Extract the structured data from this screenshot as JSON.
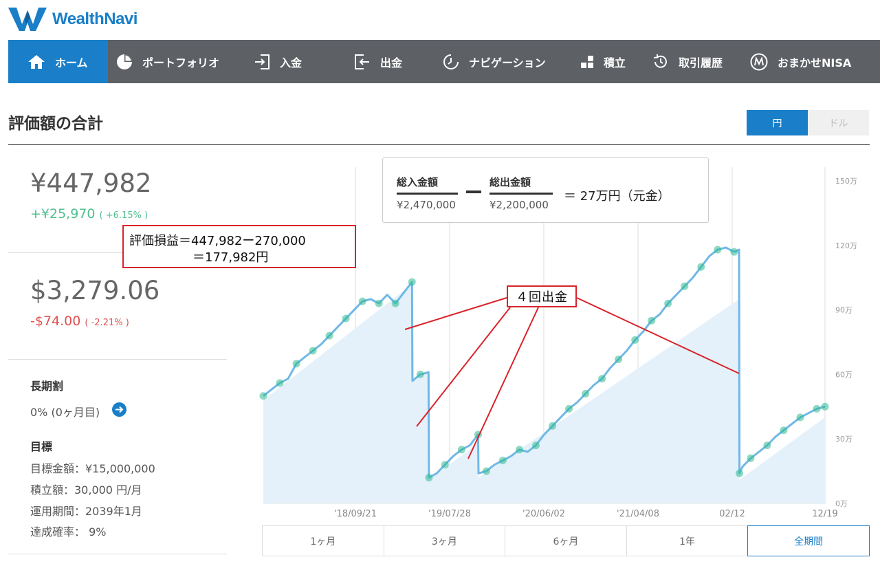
{
  "brand": {
    "name": "WealthNavi"
  },
  "nav": [
    {
      "label": "ホーム",
      "icon": "home-icon",
      "active": true
    },
    {
      "label": "ポートフォリオ",
      "icon": "pie-chart-icon",
      "active": false
    },
    {
      "label": "入金",
      "icon": "deposit-icon",
      "active": false
    },
    {
      "label": "出金",
      "icon": "withdraw-icon",
      "active": false
    },
    {
      "label": "ナビゲーション",
      "icon": "clock-icon",
      "active": false
    },
    {
      "label": "積立",
      "icon": "blocks-icon",
      "active": false
    },
    {
      "label": "取引履歴",
      "icon": "history-icon",
      "active": false
    },
    {
      "label": "おまかせNISA",
      "icon": "nisa-logo-icon",
      "active": false
    }
  ],
  "page": {
    "title": "評価額の合計"
  },
  "currency_toggle": {
    "yen": "円",
    "dollar": "ドル",
    "selected": "円"
  },
  "summary": {
    "yen_value": "¥447,982",
    "yen_change": "+¥25,970",
    "yen_change_pct": "( +6.15% )",
    "usd_value": "$3,279.06",
    "usd_change": "-$74.00",
    "usd_change_pct": "( -2.21% )"
  },
  "long_term": {
    "heading": "長期割",
    "status": "0% (0ヶ月目)"
  },
  "goal": {
    "heading": "目標",
    "target_amount": "目標金額：¥15,000,000",
    "monthly": "積立額：30,000 円/月",
    "period": "運用期間：2039年1月",
    "probability": "達成確率： 9%"
  },
  "annotations": {
    "profit_line1": "評価損益＝447,982ー270,000",
    "profit_line2": "＝177,982円",
    "withdrawals": "４回出金"
  },
  "formula": {
    "deposit_label": "総入金額",
    "deposit_amount": "¥2,470,000",
    "withdraw_label": "総出金額",
    "withdraw_amount": "¥2,200,000",
    "result": "＝ 27万円（元金）"
  },
  "chart_data": {
    "type": "area",
    "x_ticks": [
      "'18/09/21",
      "'19/07/28",
      "'20/06/02",
      "'21/04/08",
      "02/12",
      "12/19"
    ],
    "y_ticks": [
      "150万",
      "120万",
      "90万",
      "60万",
      "30万",
      "0万"
    ],
    "ylim": [
      0,
      150
    ],
    "y_unit": "万円",
    "grid": true,
    "series": [
      {
        "role": "valuation",
        "color": "#7cc0e8",
        "points": [
          [
            0,
            50
          ],
          [
            1,
            53
          ],
          [
            2,
            56
          ],
          [
            3,
            58
          ],
          [
            4,
            65
          ],
          [
            5,
            68
          ],
          [
            6,
            71
          ],
          [
            7,
            74
          ],
          [
            8,
            78
          ],
          [
            9,
            82
          ],
          [
            10,
            86
          ],
          [
            11,
            90
          ],
          [
            12,
            94
          ],
          [
            13,
            95
          ],
          [
            14,
            93
          ],
          [
            15,
            97
          ],
          [
            16,
            93
          ],
          [
            17,
            98
          ],
          [
            18,
            103
          ],
          [
            18.05,
            57
          ],
          [
            19,
            60
          ],
          [
            20,
            61
          ],
          [
            20.05,
            12
          ],
          [
            21,
            14
          ],
          [
            22,
            18
          ],
          [
            23,
            22
          ],
          [
            24,
            25
          ],
          [
            25,
            27
          ],
          [
            26,
            32
          ],
          [
            26.05,
            14
          ],
          [
            27,
            15
          ],
          [
            28,
            18
          ],
          [
            29,
            20
          ],
          [
            30,
            22
          ],
          [
            31,
            25
          ],
          [
            32,
            24
          ],
          [
            33,
            27
          ],
          [
            34,
            32
          ],
          [
            35,
            36
          ],
          [
            36,
            40
          ],
          [
            37,
            44
          ],
          [
            38,
            47
          ],
          [
            39,
            51
          ],
          [
            40,
            55
          ],
          [
            41,
            58
          ],
          [
            42,
            63
          ],
          [
            43,
            67
          ],
          [
            44,
            71
          ],
          [
            45,
            76
          ],
          [
            46,
            80
          ],
          [
            47,
            85
          ],
          [
            48,
            88
          ],
          [
            49,
            93
          ],
          [
            50,
            97
          ],
          [
            51,
            101
          ],
          [
            52,
            105
          ],
          [
            53,
            110
          ],
          [
            54,
            115
          ],
          [
            55,
            118
          ],
          [
            56,
            119
          ],
          [
            57,
            117
          ],
          [
            57.6,
            118
          ],
          [
            57.65,
            14
          ],
          [
            58,
            17
          ],
          [
            59,
            21
          ],
          [
            60,
            24
          ],
          [
            61,
            27
          ],
          [
            62,
            31
          ],
          [
            63,
            34
          ],
          [
            64,
            37
          ],
          [
            65,
            40
          ],
          [
            66,
            42
          ],
          [
            67,
            44
          ],
          [
            68,
            45
          ]
        ]
      },
      {
        "role": "principal",
        "color": "#e4f1fb",
        "points": [
          [
            0,
            48
          ],
          [
            18,
            102
          ],
          [
            18.05,
            58
          ],
          [
            20,
            61
          ],
          [
            20.05,
            11
          ],
          [
            26,
            28
          ],
          [
            26.05,
            12
          ],
          [
            57.6,
            95
          ],
          [
            57.65,
            11
          ],
          [
            68,
            40
          ]
        ]
      }
    ]
  },
  "periods": [
    {
      "label": "1ヶ月",
      "active": false
    },
    {
      "label": "3ヶ月",
      "active": false
    },
    {
      "label": "6ヶ月",
      "active": false
    },
    {
      "label": "1年",
      "active": false
    },
    {
      "label": "全期間",
      "active": true
    }
  ],
  "colors": {
    "brand": "#1a7fc8",
    "nav_bg": "#5d6065",
    "gain": "#4fbf8f",
    "loss": "#e05050",
    "annotation": "#d9232a"
  }
}
